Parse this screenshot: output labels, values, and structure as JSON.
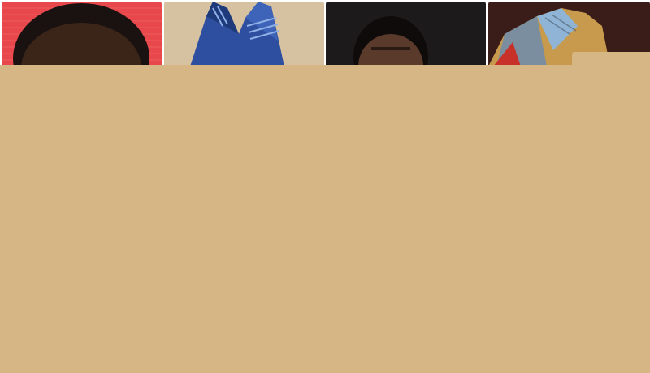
{
  "gallery": {
    "thumbnails": [
      {
        "icon": "portrait-photo",
        "background": "#e8474b"
      },
      {
        "icon": "fabric-photo",
        "background": "#d6c1a0"
      },
      {
        "icon": "portrait-photo",
        "background": "#1c1a1a"
      },
      {
        "icon": "fabric-photo",
        "background": "#3a1c18"
      }
    ]
  },
  "overlay": {
    "color": "#d6b684"
  }
}
